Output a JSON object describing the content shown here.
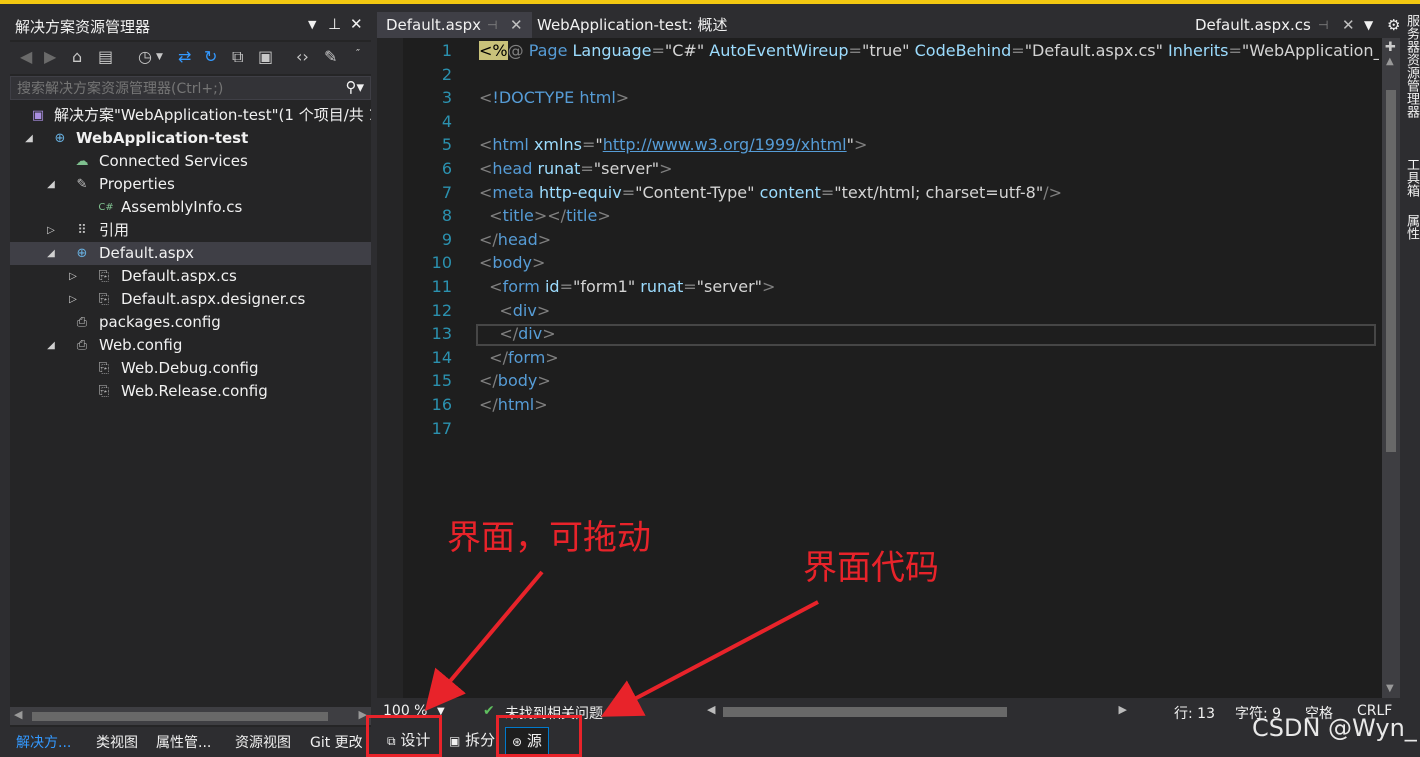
{
  "solution_explorer": {
    "title": "解决方案资源管理器",
    "search_placeholder": "搜索解决方案资源管理器(Ctrl+;)",
    "tree": [
      {
        "label": "解决方案\"WebApplication-test\"(1 个项目/共 1",
        "icon": "solution-icon",
        "expand": ""
      },
      {
        "label": "WebApplication-test",
        "icon": "web-project-icon",
        "expand": "◢",
        "bold": true
      },
      {
        "label": "Connected Services",
        "icon": "connected-services-icon",
        "expand": ""
      },
      {
        "label": "Properties",
        "icon": "wrench-icon",
        "expand": "◢"
      },
      {
        "label": "AssemblyInfo.cs",
        "icon": "csharp-file-icon",
        "expand": ""
      },
      {
        "label": "引用",
        "icon": "references-icon",
        "expand": "▷"
      },
      {
        "label": "Default.aspx",
        "icon": "aspx-file-icon",
        "expand": "◢",
        "selected": true
      },
      {
        "label": "Default.aspx.cs",
        "icon": "cs-file-icon",
        "expand": "▷"
      },
      {
        "label": "Default.aspx.designer.cs",
        "icon": "cs-file-icon",
        "expand": "▷"
      },
      {
        "label": "packages.config",
        "icon": "config-file-icon",
        "expand": ""
      },
      {
        "label": "Web.config",
        "icon": "config-file-icon",
        "expand": "◢"
      },
      {
        "label": "Web.Debug.config",
        "icon": "config-file-icon",
        "expand": ""
      },
      {
        "label": "Web.Release.config",
        "icon": "config-file-icon",
        "expand": ""
      }
    ],
    "bottom_tabs": [
      "解决方...",
      "类视图",
      "属性管...",
      "资源视图",
      "Git 更改"
    ]
  },
  "editor": {
    "tabs": {
      "active": "Default.aspx",
      "overview": "WebApplication-test: 概述",
      "right": "Default.aspx.cs"
    },
    "line_numbers": [
      "1",
      "2",
      "3",
      "4",
      "5",
      "6",
      "7",
      "8",
      "9",
      "10",
      "11",
      "12",
      "13",
      "14",
      "15",
      "16",
      "17"
    ],
    "code": {
      "l1_open": "<%",
      "l1_at": "@",
      "l1_page": " Page ",
      "l1_a1": "Language",
      "l1_v1": "\"C#\"",
      "l1_a2": "AutoEventWireup",
      "l1_v2": "\"true\"",
      "l1_a3": "CodeBehind",
      "l1_v3": "\"Default.aspx.cs\"",
      "l1_a4": "Inherits",
      "l1_v4": "\"WebApplication_te",
      "l3_doctype": "!DOCTYPE",
      "l3_html": "html",
      "l5_tag": "html",
      "l5_attr": "xmlns",
      "l5_url": "http://www.w3.org/1999/xhtml",
      "l6_tag": "head",
      "l6_attr": "runat",
      "l6_val": "\"server\"",
      "l7_tag": "meta",
      "l7_a1": "http-equiv",
      "l7_v1": "\"Content-Type\"",
      "l7_a2": "content",
      "l7_v2": "\"text/html; charset=utf-8\"",
      "l8_tag": "title",
      "l9_tag": "head",
      "l10_tag": "body",
      "l11_tag": "form",
      "l11_a1": "id",
      "l11_v1": "\"form1\"",
      "l11_a2": "runat",
      "l11_v2": "\"server\"",
      "l12_tag": "div",
      "l13_tag": "div",
      "l14_tag": "form",
      "l15_tag": "body",
      "l16_tag": "html"
    }
  },
  "status_bar": {
    "zoom": "100 %",
    "issues": "未找到相关问题",
    "line": "行: 13",
    "char": "字符: 9",
    "spaces": "空格",
    "eol": "CRLF"
  },
  "view_buttons": {
    "design": "设计",
    "split": "拆分",
    "source": "源"
  },
  "right_panel": [
    "服务器资源管理器",
    "工具箱",
    "属性"
  ],
  "annotations": {
    "design_note": "界面，可拖动",
    "source_note": "界面代码"
  },
  "watermark": "CSDN @Wyn_",
  "colors": {
    "accent": "#007acc",
    "annotation_red": "#e8232a",
    "tag_blue": "#569cd6",
    "attr_lightblue": "#9cdcfe",
    "line_number": "#2b91af"
  }
}
